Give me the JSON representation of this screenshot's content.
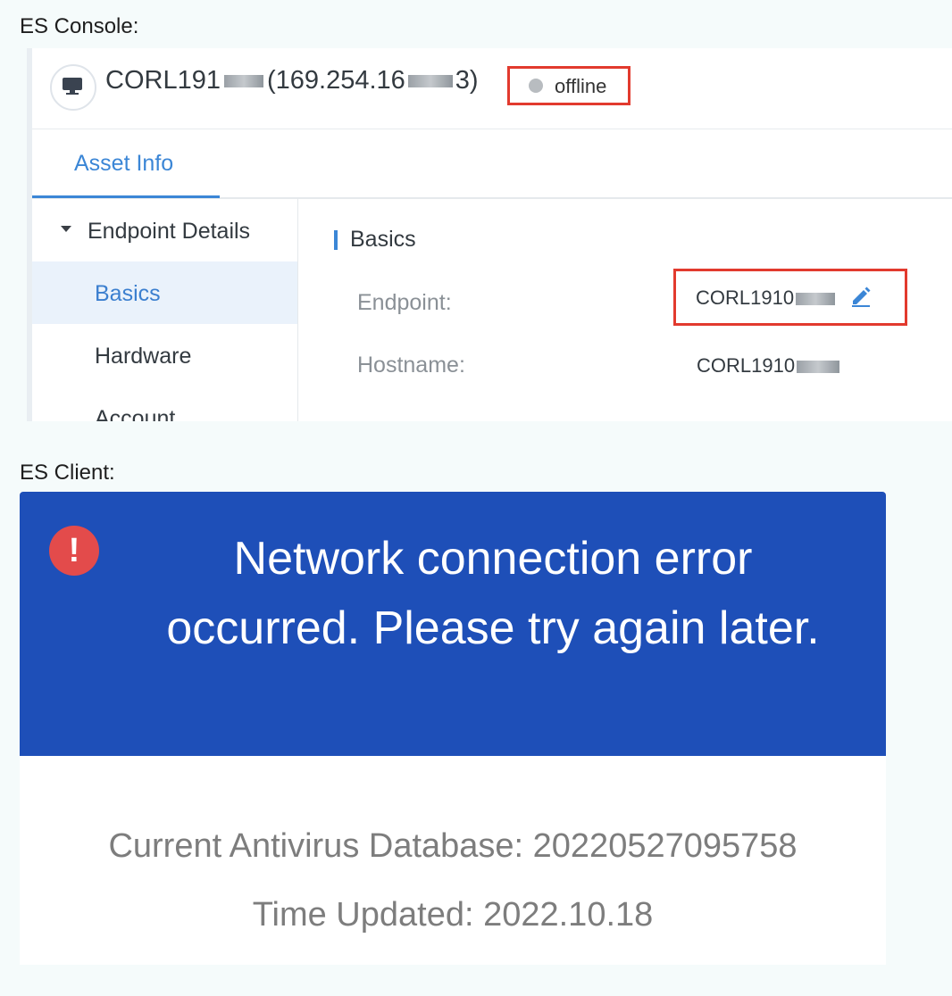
{
  "captions": {
    "console": "ES Console:",
    "client": "ES Client:"
  },
  "console": {
    "header": {
      "icon": "desktop-computer-icon",
      "host_prefix": "CORL191",
      "ip_prefix": "(169.254.16",
      "ip_suffix": "3)",
      "status": "offline",
      "status_color": "#b8bcc0",
      "highlight_color": "#e23a2e"
    },
    "tabs": [
      {
        "label": "Asset Info",
        "active": true
      }
    ],
    "nav": {
      "group_label": "Endpoint Details",
      "items": [
        {
          "label": "Basics",
          "active": true
        },
        {
          "label": "Hardware",
          "active": false
        },
        {
          "label": "Account",
          "active": false
        }
      ]
    },
    "basics": {
      "section_title": "Basics",
      "rows": [
        {
          "label": "Endpoint:",
          "value": "CORL1910",
          "editable": true
        },
        {
          "label": "Hostname:",
          "value": "CORL1910"
        }
      ]
    },
    "accent_color": "#3b86d6"
  },
  "client": {
    "banner_color": "#1e4fb8",
    "error_icon": "exclamation-circle-icon",
    "error_line1": "Network connection error",
    "error_line2": "occurred. Please try again later.",
    "db_line": "Current Antivirus Database: 20220527095758",
    "updated_line": "Time Updated: 2022.10.18"
  }
}
